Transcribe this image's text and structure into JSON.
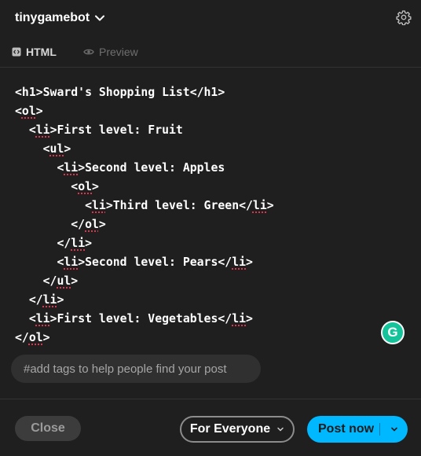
{
  "header": {
    "blog_name": "tinygamebot",
    "icons": [
      "chevron-down-icon",
      "gear-icon"
    ]
  },
  "tabs": [
    {
      "label": "HTML",
      "icon": "code-icon",
      "active": true
    },
    {
      "label": "Preview",
      "icon": "eye-icon",
      "active": false
    }
  ],
  "code_lines": [
    "<h1>Sward's Shopping List</h1>",
    "<ol>",
    "  <li>First level: Fruit",
    "    <ul>",
    "      <li>Second level: Apples",
    "        <ol>",
    "          <li>Third level: Green</li>",
    "        </ol>",
    "      </li>",
    "      <li>Second level: Pears</li>",
    "    </ul>",
    "  </li>",
    "  <li>First level: Vegetables</li>",
    "</ol>"
  ],
  "grammarly": {
    "glyph": "G",
    "color": "#15c39a"
  },
  "tags": {
    "placeholder": "#add tags to help people find your post",
    "value": ""
  },
  "footer": {
    "close_label": "Close",
    "audience_label": "For Everyone",
    "post_label": "Post now"
  },
  "colors": {
    "background": "#1f1f1f",
    "accent": "#00b8ff",
    "spell_underline": "#e0334e"
  }
}
